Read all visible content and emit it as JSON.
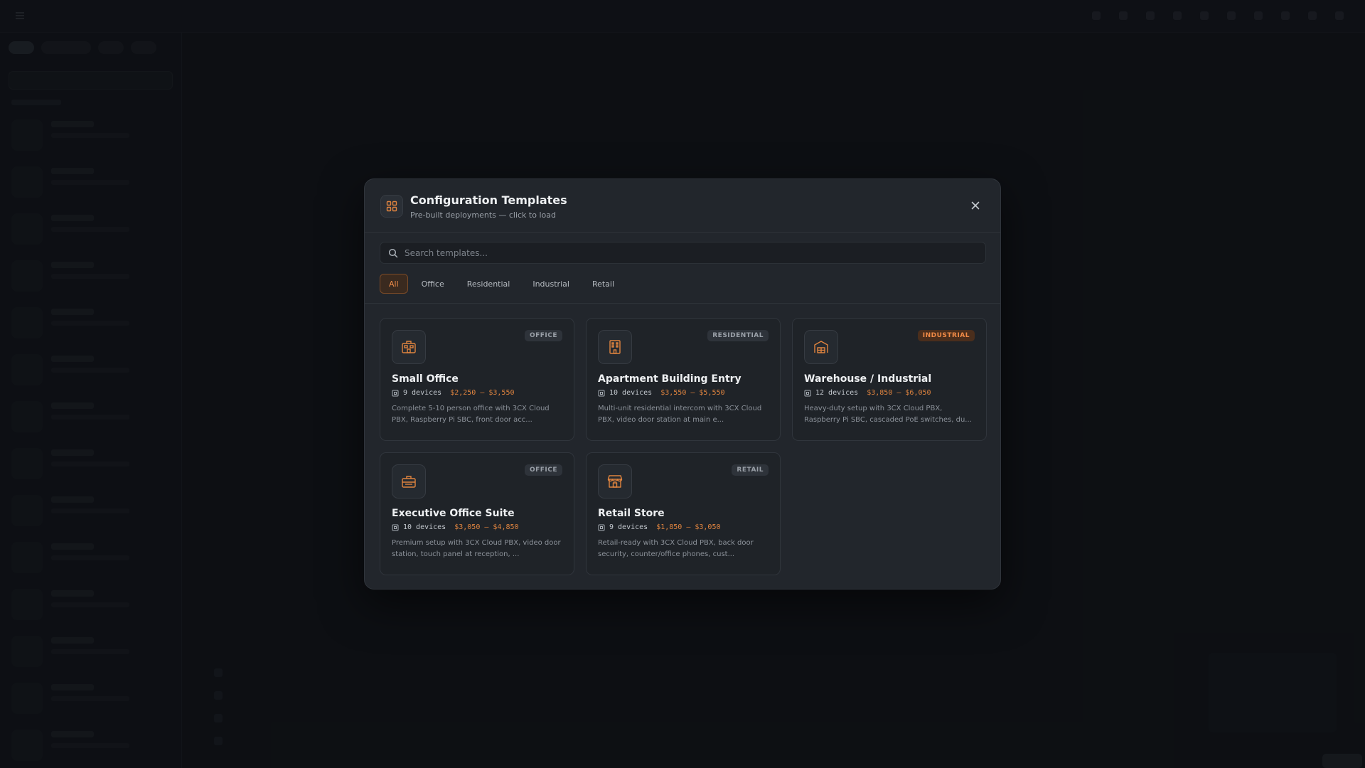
{
  "modal": {
    "title": "Configuration Templates",
    "subtitle": "Pre-built deployments — click to load",
    "search_placeholder": "Search templates...",
    "filters": [
      "All",
      "Office",
      "Residential",
      "Industrial",
      "Retail"
    ],
    "active_filter": "All",
    "accent_color": "#e0843f",
    "templates": [
      {
        "title": "Small Office",
        "category": "OFFICE",
        "devices": "9 devices",
        "price": "$2,250 – $3,550",
        "description": "Complete 5-10 person office with 3CX Cloud PBX, Raspberry Pi SBC, front door acc...",
        "icon": "office-building-icon"
      },
      {
        "title": "Apartment Building Entry",
        "category": "RESIDENTIAL",
        "devices": "10 devices",
        "price": "$3,550 – $5,550",
        "description": "Multi-unit residential intercom with 3CX Cloud PBX, video door station at main e...",
        "icon": "apartment-building-icon"
      },
      {
        "title": "Warehouse / Industrial",
        "category": "INDUSTRIAL",
        "devices": "12 devices",
        "price": "$3,850 – $6,050",
        "description": "Heavy-duty setup with 3CX Cloud PBX, Raspberry Pi SBC, cascaded PoE switches, du...",
        "icon": "warehouse-icon"
      },
      {
        "title": "Executive Office Suite",
        "category": "OFFICE",
        "devices": "10 devices",
        "price": "$3,050 – $4,850",
        "description": "Premium setup with 3CX Cloud PBX, video door station, touch panel at reception, ...",
        "icon": "briefcase-icon"
      },
      {
        "title": "Retail Store",
        "category": "RETAIL",
        "devices": "9 devices",
        "price": "$1,850 – $3,050",
        "description": "Retail-ready with 3CX Cloud PBX, back door security, counter/office phones, cust...",
        "icon": "storefront-icon"
      }
    ]
  }
}
